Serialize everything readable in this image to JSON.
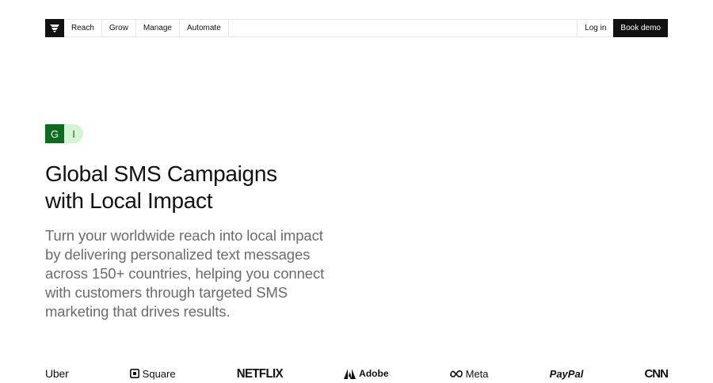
{
  "nav": {
    "items": [
      {
        "label": "Reach"
      },
      {
        "label": "Grow"
      },
      {
        "label": "Manage"
      },
      {
        "label": "Automate"
      }
    ],
    "login_label": "Log in",
    "demo_label": "Book demo"
  },
  "badges": {
    "first": "G",
    "second": "I"
  },
  "hero": {
    "title_line1": "Global SMS Campaigns",
    "title_line2": "with Local Impact",
    "description": "Turn your worldwide reach into local impact by delivering personalized text messages across 150+ countries, helping you connect with customers through targeted SMS marketing that drives results."
  },
  "logos": [
    {
      "name": "Uber",
      "icon": "uber-logo"
    },
    {
      "name": "Square",
      "icon": "square-logo"
    },
    {
      "name": "NETFLIX",
      "icon": "netflix-logo"
    },
    {
      "name": "Adobe",
      "icon": "adobe-logo"
    },
    {
      "name": "Meta",
      "icon": "meta-logo"
    },
    {
      "name": "PayPal",
      "icon": "paypal-logo"
    },
    {
      "name": "CNN",
      "icon": "cnn-logo"
    }
  ],
  "colors": {
    "badge_dark": "#0d6b1f",
    "badge_light": "#d4f5d4",
    "button_dark": "#111111",
    "muted_text": "#6b6b6b"
  }
}
